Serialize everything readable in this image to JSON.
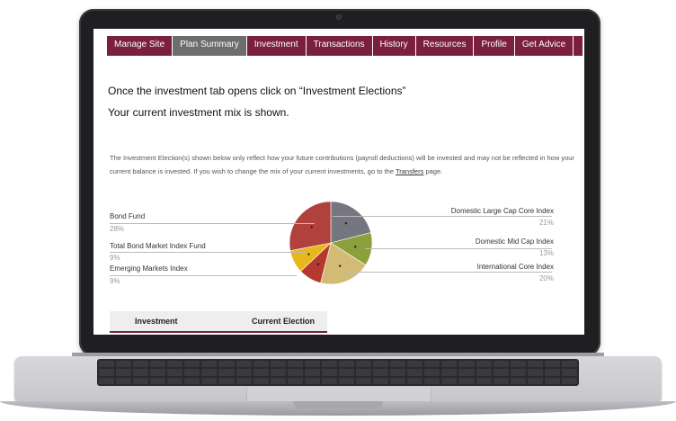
{
  "nav": {
    "items": [
      {
        "label": "Manage Site",
        "active": false
      },
      {
        "label": "Plan Summary",
        "active": true
      },
      {
        "label": "Investment",
        "active": false
      },
      {
        "label": "Transactions",
        "active": false
      },
      {
        "label": "History",
        "active": false
      },
      {
        "label": "Resources",
        "active": false
      },
      {
        "label": "Profile",
        "active": false
      },
      {
        "label": "Get Advice",
        "active": false
      }
    ]
  },
  "instructions": {
    "line1": "Once the investment tab opens click on “Investment Elections”",
    "line2": "Your current investment mix is shown."
  },
  "notice": {
    "text_before": "The Investment Election(s) shown below only reflect how your future contributions (payroll deductions) will be invested and may not be reflected in how your current balance is invested. If you wish to change the mix of your current investments, go to the ",
    "link": "Transfers",
    "text_after": " page."
  },
  "chart_data": {
    "type": "pie",
    "slices": [
      {
        "label": "Domestic Large Cap Core Index",
        "value": 21,
        "pct_text": "21%",
        "color": "#767680"
      },
      {
        "label": "Domestic Mid Cap Index",
        "value": 13,
        "pct_text": "13%",
        "color": "#8ba03a"
      },
      {
        "label": "International Core Index",
        "value": 20,
        "pct_text": "20%",
        "color": "#d2bb74"
      },
      {
        "label": "Emerging Markets Index",
        "value": 9,
        "pct_text": "9%",
        "color": "#b5392f"
      },
      {
        "label": "Total Bond Market Index Fund",
        "value": 9,
        "pct_text": "9%",
        "color": "#e8b81a"
      },
      {
        "label": "Bond Fund",
        "value": 28,
        "pct_text": "28%",
        "color": "#b0413c"
      }
    ]
  },
  "table": {
    "col1": "Investment",
    "col2": "Current Election"
  }
}
